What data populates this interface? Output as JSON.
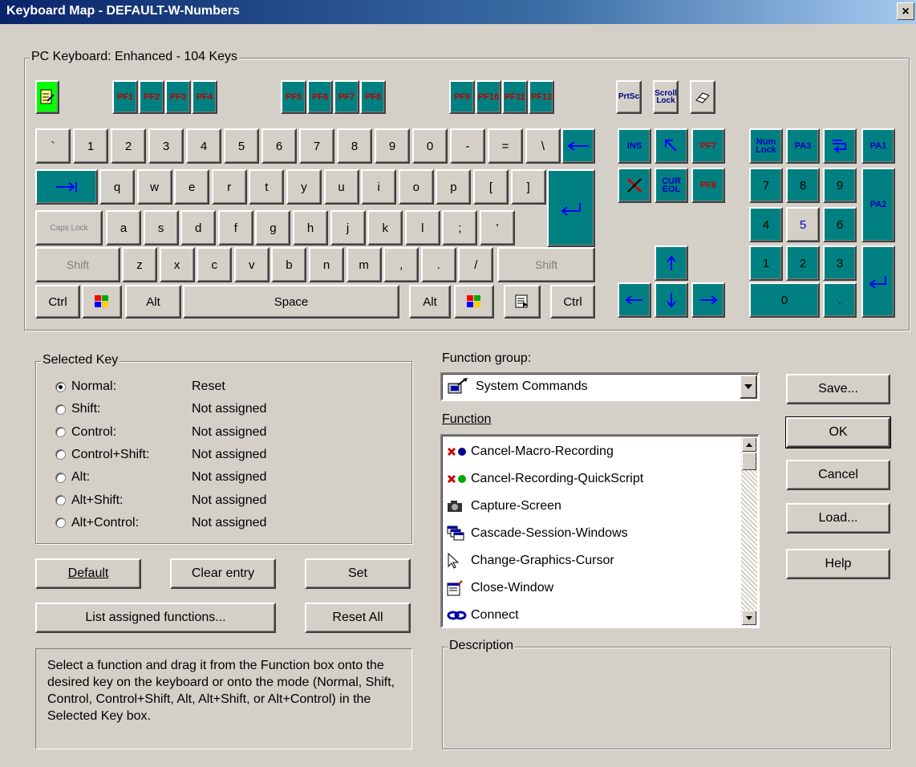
{
  "window": {
    "title": "Keyboard Map - DEFAULT-W-Numbers",
    "close_glyph": "×"
  },
  "keyboard_group": {
    "legend": "PC Keyboard:  Enhanced - 104 Keys"
  },
  "fkeys": [
    "PF1",
    "PF2",
    "PF3",
    "PF4",
    "PF5",
    "PF6",
    "PF7",
    "PF8",
    "PF9",
    "PF10",
    "PF11",
    "PF12"
  ],
  "special_keys": {
    "prtsc": "PrtSc",
    "scroll_lock": "Scroll Lock"
  },
  "row1": [
    "`",
    "1",
    "2",
    "3",
    "4",
    "5",
    "6",
    "7",
    "8",
    "9",
    "0",
    "-",
    "=",
    "\\"
  ],
  "row2": [
    "q",
    "w",
    "e",
    "r",
    "t",
    "y",
    "u",
    "i",
    "o",
    "p",
    "[",
    "]"
  ],
  "row3": [
    "a",
    "s",
    "d",
    "f",
    "g",
    "h",
    "j",
    "k",
    "l",
    ";",
    "'"
  ],
  "row4": [
    "z",
    "x",
    "c",
    "v",
    "b",
    "n",
    "m",
    ",",
    ".",
    "/"
  ],
  "labels": {
    "caps_lock": "Caps Lock",
    "shift": "Shift",
    "ctrl": "Ctrl",
    "alt": "Alt",
    "space": "Space"
  },
  "nav_keys": {
    "ins": "INS",
    "pf7": "PF7",
    "pf8": "PF8",
    "cur_eol": "CUR EOL"
  },
  "numpad": {
    "num_lock": "Num Lock",
    "pa3": "PA3",
    "pa1": "PA1",
    "pa2": "PA2",
    "n7": "7",
    "n8": "8",
    "n9": "9",
    "n4": "4",
    "n5": "5",
    "n6": "6",
    "n1": "1",
    "n2": "2",
    "n3": "3",
    "n0": "0",
    "dot": "."
  },
  "selected_key": {
    "legend": "Selected Key",
    "modes": [
      {
        "label": "Normal:",
        "value": "Reset",
        "checked": true
      },
      {
        "label": "Shift:",
        "value": "Not assigned",
        "checked": false
      },
      {
        "label": "Control:",
        "value": "Not assigned",
        "checked": false
      },
      {
        "label": "Control+Shift:",
        "value": "Not assigned",
        "checked": false
      },
      {
        "label": "Alt:",
        "value": "Not assigned",
        "checked": false
      },
      {
        "label": "Alt+Shift:",
        "value": "Not assigned",
        "checked": false
      },
      {
        "label": "Alt+Control:",
        "value": "Not assigned",
        "checked": false
      }
    ]
  },
  "buttons": {
    "default": "Default",
    "clear_entry": "Clear entry",
    "set": "Set",
    "list_assigned": "List assigned functions...",
    "reset_all": "Reset All",
    "save": "Save...",
    "ok": "OK",
    "cancel": "Cancel",
    "load": "Load...",
    "help": "Help"
  },
  "help_text": "Select a function and drag it from the Function box onto the desired key on the keyboard or onto the mode (Normal, Shift, Control, Control+Shift, Alt, Alt+Shift, or Alt+Control) in the Selected Key box.",
  "function_group": {
    "label": "Function group:",
    "selected": "System Commands"
  },
  "function_list": {
    "label": "Function",
    "items": [
      "Cancel-Macro-Recording",
      "Cancel-Recording-QuickScript",
      "Capture-Screen",
      "Cascade-Session-Windows",
      "Change-Graphics-Cursor",
      "Close-Window",
      "Connect"
    ]
  },
  "description": {
    "legend": "Description"
  }
}
